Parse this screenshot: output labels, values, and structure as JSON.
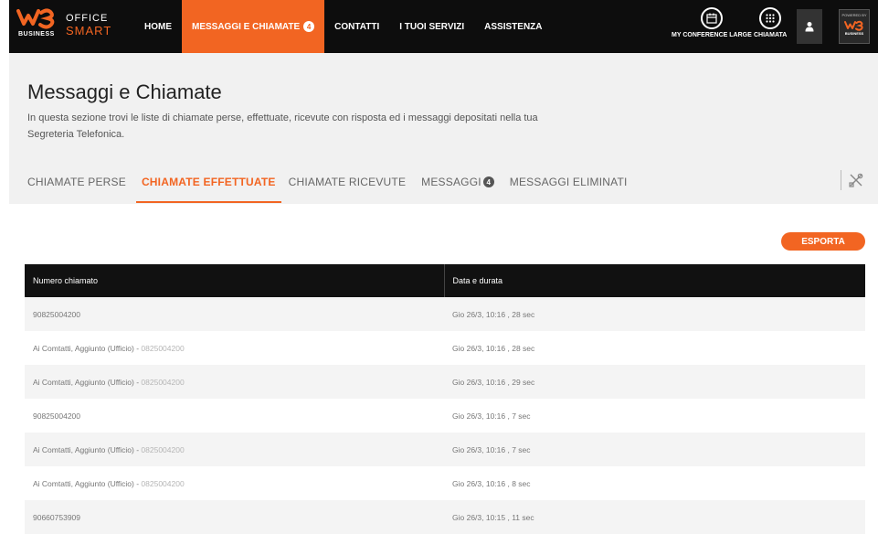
{
  "brand": {
    "logo_text": "W3",
    "business": "BUSINESS",
    "office": "OFFICE",
    "smart": "SMART",
    "accent_color": "#f26522"
  },
  "nav": {
    "items": [
      {
        "label": "HOME",
        "active": false
      },
      {
        "label": "MESSAGGI E CHIAMATE",
        "active": true,
        "badge": "4"
      },
      {
        "label": "CONTATTI",
        "active": false
      },
      {
        "label": "I TUOI SERVIZI",
        "active": false
      },
      {
        "label": "ASSISTENZA",
        "active": false
      }
    ]
  },
  "toolbar": {
    "conference_label": "MY CONFERENCE LARGE",
    "chiamata_label": "CHIAMATA",
    "powered_by": "POWERED BY",
    "powered_business": "BUSINESS"
  },
  "header": {
    "title": "Messaggi e Chiamate",
    "description": "In questa sezione trovi le liste di chiamate perse, effettuate, ricevute con risposta ed i messaggi depositati nella tua Segreteria Telefonica."
  },
  "tabs": [
    {
      "label": "CHIAMATE PERSE",
      "active": false
    },
    {
      "label": "CHIAMATE EFFETTUATE",
      "active": true
    },
    {
      "label": "CHIAMATE RICEVUTE",
      "active": false
    },
    {
      "label": "MESSAGGI",
      "active": false,
      "badge": "4"
    },
    {
      "label": "MESSAGGI ELIMINATI",
      "active": false
    }
  ],
  "actions": {
    "export_label": "ESPORTA"
  },
  "table": {
    "columns": [
      "Numero chiamato",
      "Data e durata"
    ],
    "rows": [
      {
        "name": "",
        "number": "90825004200",
        "date": "Gio 26/3, 10:16 , 28 sec"
      },
      {
        "name": "Ai Comtatti, Aggiunto (Ufficio) - ",
        "number": "0825004200",
        "date": "Gio 26/3, 10:16 , 28 sec"
      },
      {
        "name": "Ai Comtatti, Aggiunto (Ufficio) - ",
        "number": "0825004200",
        "date": "Gio 26/3, 10:16 , 29 sec"
      },
      {
        "name": "",
        "number": "90825004200",
        "date": "Gio 26/3, 10:16 , 7 sec"
      },
      {
        "name": "Ai Comtatti, Aggiunto (Ufficio) - ",
        "number": "0825004200",
        "date": "Gio 26/3, 10:16 , 7 sec"
      },
      {
        "name": "Ai Comtatti, Aggiunto (Ufficio) - ",
        "number": "0825004200",
        "date": "Gio 26/3, 10:16 , 8 sec"
      },
      {
        "name": "",
        "number": "90660753909",
        "date": "Gio 26/3, 10:15 , 11 sec"
      }
    ]
  }
}
